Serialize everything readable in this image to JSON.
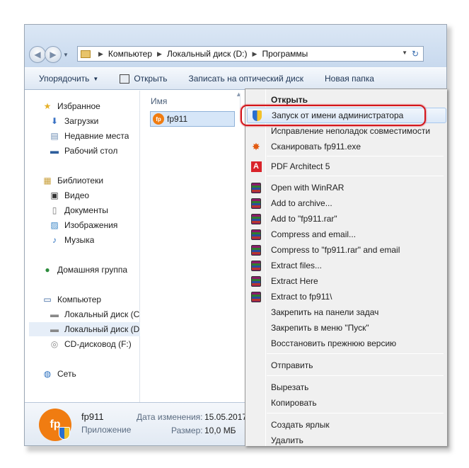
{
  "address": {
    "crumbs": [
      "Компьютер",
      "Локальный диск (D:)",
      "Программы"
    ]
  },
  "toolbar": {
    "organize": "Упорядочить",
    "open": "Открыть",
    "burn": "Записать на оптический диск",
    "new_folder": "Новая папка"
  },
  "navpane": {
    "favorites": "Избранное",
    "downloads": "Загрузки",
    "recent": "Недавние места",
    "desktop": "Рабочий стол",
    "libraries": "Библиотеки",
    "video": "Видео",
    "documents": "Документы",
    "pictures": "Изображения",
    "music": "Музыка",
    "homegroup": "Домашняя группа",
    "computer": "Компьютер",
    "disk_c": "Локальный диск (C",
    "disk_d": "Локальный диск (D",
    "cd": "CD-дисковод (F:)",
    "network": "Сеть"
  },
  "content": {
    "column_name": "Имя",
    "file": "fp911"
  },
  "details": {
    "icon_text": "fp",
    "name": "fp911",
    "type": "Приложение",
    "modified_label": "Дата изменения:",
    "modified_value": "15.05.2017",
    "size_label": "Размер:",
    "size_value": "10,0 МБ"
  },
  "menu": {
    "open": "Открыть",
    "run_as_admin": "Запуск от имени администратора",
    "troubleshoot": "Исправление неполадок совместимости",
    "scan": "Сканировать fp911.exe",
    "pdf": "PDF Architect 5",
    "winrar_open": "Open with WinRAR",
    "add_archive": "Add to archive...",
    "add_rar": "Add to \"fp911.rar\"",
    "compress_email": "Compress and email...",
    "compress_rar_email": "Compress to \"fp911.rar\" and email",
    "extract_files": "Extract files...",
    "extract_here": "Extract Here",
    "extract_to": "Extract to fp911\\",
    "pin_taskbar": "Закрепить на панели задач",
    "pin_start": "Закрепить в меню \"Пуск\"",
    "restore": "Восстановить прежнюю версию",
    "send_to": "Отправить",
    "cut": "Вырезать",
    "copy": "Копировать",
    "create_shortcut": "Создать ярлык",
    "delete": "Удалить"
  },
  "colors": {
    "highlight_box": "#d4161c",
    "app_icon": "#f07c11"
  }
}
